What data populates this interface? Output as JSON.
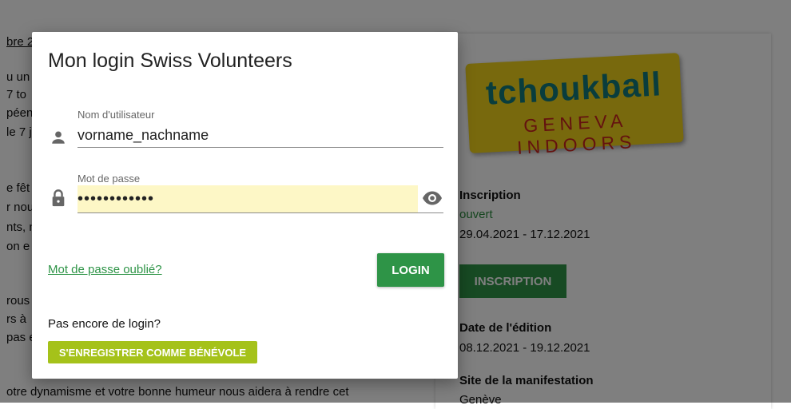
{
  "background": {
    "article_lines": [
      {
        "text": "bre 2",
        "underline": true
      },
      {
        "text": "u un"
      },
      {
        "text": "7 to"
      },
      {
        "text": "péen"
      },
      {
        "text": "le 7 j"
      },
      {
        "text": "e fêt"
      },
      {
        "text": "r nou"
      },
      {
        "text": "nts, n"
      },
      {
        "text": "on e"
      },
      {
        "text": "rous"
      },
      {
        "text": "rs à"
      },
      {
        "text": "pas e"
      },
      {
        "text": "otre dynamisme et votre bonne humeur nous aidera à rendre cet"
      }
    ],
    "logo": {
      "main": "tchoukball",
      "sub": "GENEVA INDOORS"
    },
    "info": {
      "inscription_label": "Inscription",
      "inscription_status": "ouvert",
      "inscription_dates": "29.04.2021 - 17.12.2021",
      "inscription_button": "INSCRIPTION",
      "edition_label": "Date de l'édition",
      "edition_dates": "08.12.2021 - 19.12.2021",
      "site_label": "Site de la manifestation",
      "site_value": "Genève"
    }
  },
  "modal": {
    "title": "Mon login Swiss Volunteers",
    "username_label": "Nom d'utilisateur",
    "username_value": "vorname_nachname",
    "password_label": "Mot de passe",
    "password_value": "••••••••••••",
    "forgot_link": "Mot de passe oublié?",
    "login_button": "LOGIN",
    "no_login_text": "Pas encore de login?",
    "register_button": "S'ENREGISTRER COMME BÉNÉVOLE"
  },
  "colors": {
    "primary_green": "#2e9447",
    "register_green": "#a5c21a",
    "autofill_yellow": "#fdf7c6",
    "logo_yellow": "#f1d21b"
  },
  "icons": {
    "username": "person-icon",
    "password": "lock-icon",
    "toggle_visibility": "eye-icon"
  }
}
